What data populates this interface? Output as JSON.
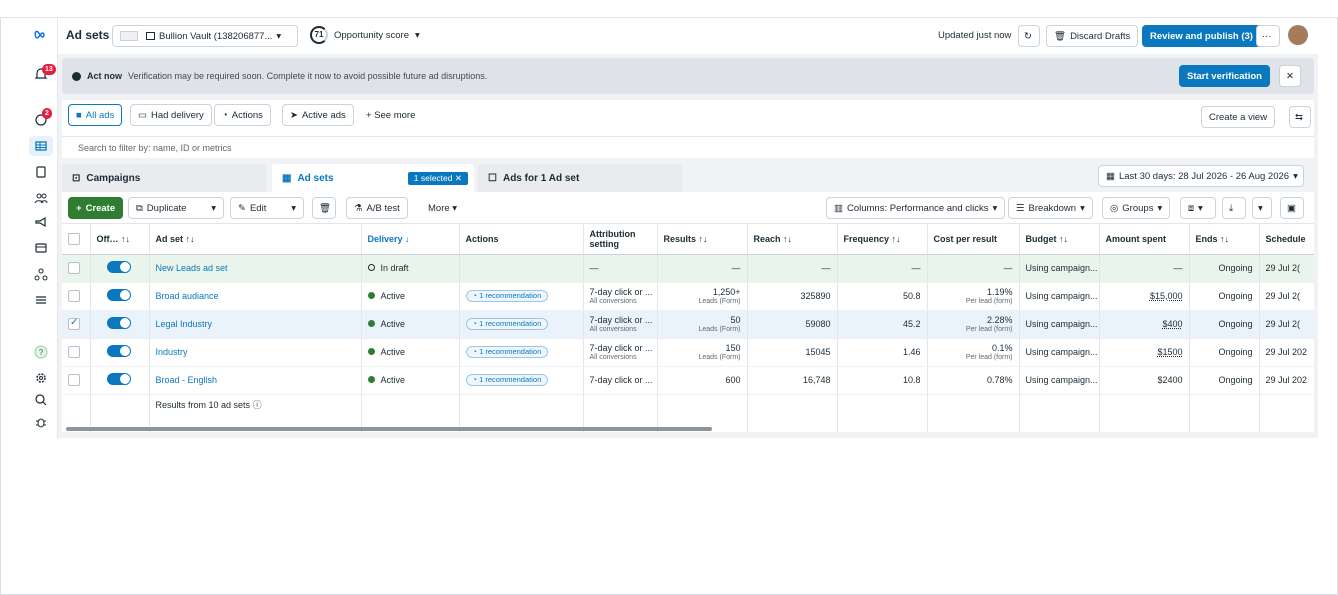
{
  "header": {
    "title": "Ad sets",
    "account": "Bullion Vault (138206877...",
    "opportunity_score": "71",
    "opportunity_label": "Opportunity score",
    "updated": "Updated just now",
    "discard": "Discard Drafts",
    "review": "Review and publish (3)",
    "more": "···"
  },
  "rail": {
    "notifications_count": "13",
    "alerts_count": "2"
  },
  "banner": {
    "title": "Act now",
    "text": "Verification may be required soon. Complete it now to avoid possible future ad disruptions.",
    "button": "Start verification"
  },
  "filters": {
    "items": [
      "All ads",
      "Had delivery",
      "Actions",
      "Active ads"
    ],
    "see_more": "See more",
    "create_view": "Create a view"
  },
  "search": {
    "placeholder": "Search to filter by: name, ID or metrics"
  },
  "tabs": {
    "campaigns": "Campaigns",
    "adsets": "Ad sets",
    "selected": "1 selected",
    "ads": "Ads for 1 Ad set",
    "date_range": "Last 30 days: 28 Jul 2026 - 26 Aug 2026"
  },
  "toolbar": {
    "create": "Create",
    "duplicate": "Duplicate",
    "edit": "Edit",
    "abtest": "A/B test",
    "more": "More",
    "columns": "Columns: Performance and clicks",
    "breakdown": "Breakdown",
    "groups": "Groups"
  },
  "table": {
    "headers": {
      "offon": "Off… ↑↓",
      "adset": "Ad set ↑↓",
      "delivery": "Delivery ↓",
      "actions": "Actions",
      "attribution": "Attribution setting",
      "results": "Results ↑↓",
      "reach": "Reach ↑↓",
      "frequency": "Frequency ↑↓",
      "cpr": "Cost per result",
      "budget": "Budget ↑↓",
      "amount": "Amount spent",
      "ends": "Ends ↑↓",
      "schedule": "Schedule"
    },
    "rows": [
      {
        "name": "New Leads ad set",
        "delivery": "In draft",
        "actions": "",
        "attr": "—",
        "attr_sub": "",
        "results": "—",
        "results_sub": "",
        "reach": "—",
        "freq": "—",
        "cpr": "—",
        "cpr_sub": "",
        "budget": "Using campaign...",
        "amount": "—",
        "ends": "Ongoing",
        "schedule": "29 Jul 2("
      },
      {
        "name": "Broad audiance",
        "delivery": "Active",
        "actions": "1 recommendation",
        "attr": "7-day click or ...",
        "attr_sub": "All conversions",
        "results": "1,250+",
        "results_sub": "Leads (Form)",
        "reach": "325890",
        "freq": "50.8",
        "cpr": "1.19%",
        "cpr_sub": "Per lead (form)",
        "budget": "Using campaign...",
        "amount": "$15,000",
        "ends": "Ongoing",
        "schedule": "29 Jul 2("
      },
      {
        "name": "Legal Industry",
        "delivery": "Active",
        "actions": "1 recommendation",
        "attr": "7-day click or ...",
        "attr_sub": "All conversions",
        "results": "50",
        "results_sub": "Leads (Form)",
        "reach": "59080",
        "freq": "45.2",
        "cpr": "2.28%",
        "cpr_sub": "Per lead (form)",
        "budget": "Using campaign...",
        "amount": "$400",
        "ends": "Ongoing",
        "schedule": "29 Jul 2("
      },
      {
        "name": "Industry",
        "delivery": "Active",
        "actions": "1 recommendation",
        "attr": "7-day click or ...",
        "attr_sub": "All conversions",
        "results": "150",
        "results_sub": "Leads (Form)",
        "reach": "15045",
        "freq": "1.46",
        "cpr": "0.1%",
        "cpr_sub": "Per lead (form)",
        "budget": "Using campaign...",
        "amount": "$1500",
        "ends": "Ongoing",
        "schedule": "29 Jul 202"
      },
      {
        "name": "Broad - English",
        "delivery": "Active",
        "actions": "1 recommendation",
        "attr": "7-day click or ...",
        "attr_sub": "",
        "results": "600",
        "results_sub": "",
        "reach": "16,748",
        "freq": "10.8",
        "cpr": "0.78%",
        "cpr_sub": "",
        "budget": "Using campaign...",
        "amount": "$2400",
        "ends": "Ongoing",
        "schedule": "29 Jul 202"
      }
    ],
    "footer": "Results from 10 ad sets"
  },
  "colors": {
    "primary": "#0a78be",
    "create": "#2e7d32",
    "active_dot": "#2e7d32",
    "alert": "#e41e3f"
  }
}
